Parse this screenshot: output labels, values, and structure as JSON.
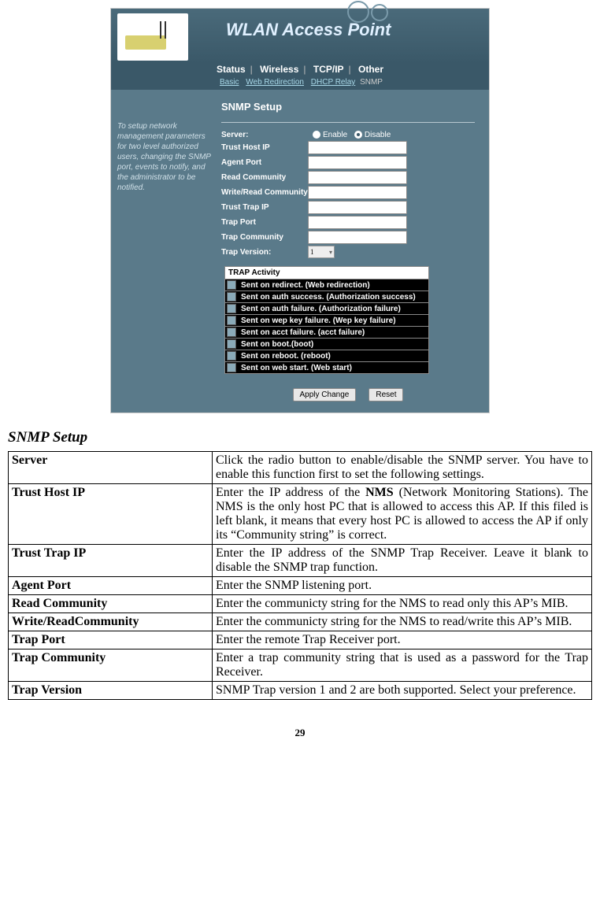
{
  "banner_title": "WLAN Access Point",
  "tabs": [
    "Status",
    "Wireless",
    "TCP/IP",
    "Other"
  ],
  "subtabs": [
    "Basic",
    "Web Redirection",
    "DHCP Relay",
    "SNMP"
  ],
  "panel_title": "SNMP Setup",
  "sidebar_text": "To setup network management parameters for two level authorized users, changing the SNMP port, events to notify, and the administrator to be notified.",
  "form": {
    "server_label": "Server:",
    "enable": "Enable",
    "disable": "Disable",
    "trust_host_ip": "Trust Host IP",
    "agent_port": "Agent Port",
    "read_community": "Read Community",
    "writeread_community": "Write/Read Community",
    "trust_trap_ip": "Trust Trap IP",
    "trap_port": "Trap Port",
    "trap_community": "Trap Community",
    "trap_version": "Trap Version:",
    "trap_version_val": "1"
  },
  "trap_activity_header": "TRAP Activity",
  "trap_activities": [
    "Sent on redirect. (Web redirection)",
    "Sent on auth success. (Authorization success)",
    "Sent on auth failure. (Authorization failure)",
    "Sent on wep key failure. (Wep key failure)",
    "Sent on acct failure. (acct failure)",
    "Sent on boot.(boot)",
    "Sent on reboot. (reboot)",
    "Sent on web start. (Web start)"
  ],
  "buttons": {
    "apply": "Apply Change",
    "reset": "Reset"
  },
  "section_heading": "SNMP Setup",
  "descriptions": [
    {
      "term": "Server",
      "def_parts": [
        "Click the radio button to enable/disable the SNMP server.  You have to enable this function first to set the following settings."
      ]
    },
    {
      "term": "Trust Host IP",
      "def_parts": [
        "Enter the IP address of the ",
        "NMS",
        " (Network Monitoring Stations). The NMS is the only host PC that is allowed to access this AP. If this filed is left blank, it means that every host PC is allowed to access the AP if only its  “Community string” is correct."
      ]
    },
    {
      "term": "Trust Trap IP",
      "def_parts": [
        "Enter the IP address of the SNMP Trap Receiver.  Leave it blank to disable the SNMP trap function."
      ]
    },
    {
      "term": "Agent Port",
      "def_parts": [
        "Enter the SNMP listening port."
      ]
    },
    {
      "term": "Read Community",
      "def_parts": [
        "Enter the communicty string for the NMS to read only this AP’s MIB."
      ]
    },
    {
      "term": "Write/ReadCommunity",
      "def_parts": [
        "Enter the communicty string for the NMS to read/write this AP’s MIB."
      ]
    },
    {
      "term": "Trap Port",
      "def_parts": [
        "Enter the remote Trap Receiver port."
      ]
    },
    {
      "term": "Trap Community",
      "def_parts": [
        "Enter a trap community string that is used as a password for the Trap Receiver."
      ]
    },
    {
      "term": "Trap Version",
      "def_parts": [
        "SNMP Trap version 1 and 2 are both supported. Select your preference."
      ]
    }
  ],
  "page_number": "29"
}
